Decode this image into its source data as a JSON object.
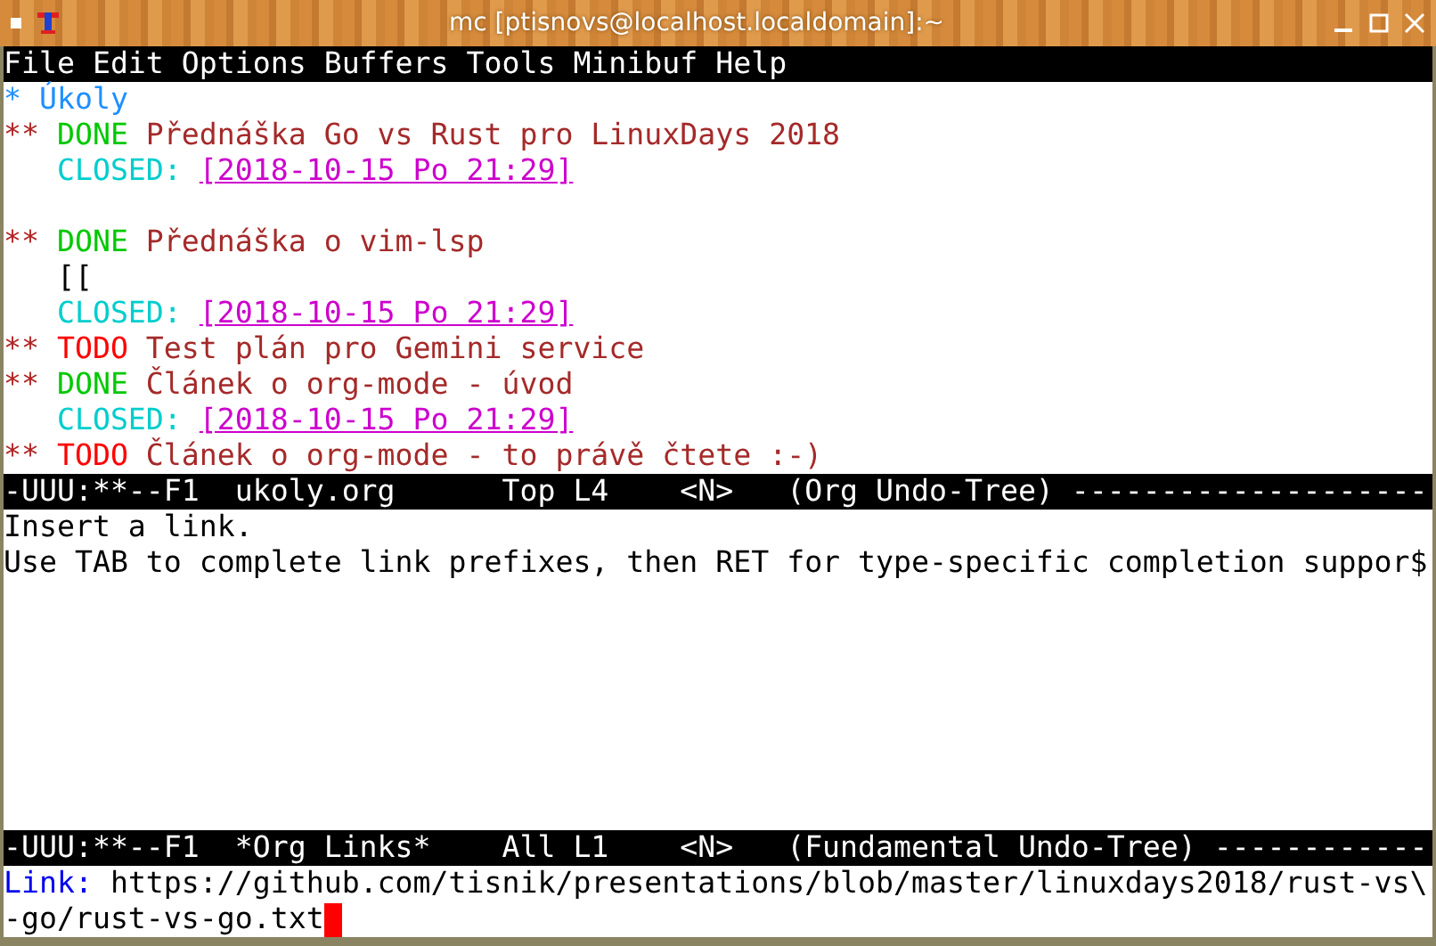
{
  "window": {
    "title": "mc [ptisnovs@localhost.localdomain]:~"
  },
  "menu": [
    "File",
    "Edit",
    "Options",
    "Buffers",
    "Tools",
    "Minibuf",
    "Help"
  ],
  "buffer": [
    {
      "kind": "line",
      "segments": [
        {
          "kind": "h1star",
          "text": "*"
        },
        {
          "kind": "h1",
          "text": "Úkoly"
        }
      ]
    },
    {
      "kind": "line",
      "segments": [
        {
          "kind": "stars",
          "text": "**"
        },
        {
          "kind": "done",
          "text": "DONE"
        },
        {
          "kind": "heading",
          "text": "Přednáška Go vs Rust pro LinuxDays 2018"
        }
      ]
    },
    {
      "kind": "body",
      "segments": [
        {
          "kind": "property",
          "text": "CLOSED:"
        },
        {
          "kind": "timestamp",
          "text": "[2018-10-15 Po 21:29]"
        }
      ]
    },
    {
      "kind": "blank"
    },
    {
      "kind": "line",
      "segments": [
        {
          "kind": "stars",
          "text": "**"
        },
        {
          "kind": "done",
          "text": "DONE"
        },
        {
          "kind": "heading",
          "text": "Přednáška o vim-lsp"
        }
      ]
    },
    {
      "kind": "body",
      "segments": [
        {
          "kind": "plain",
          "text": "[["
        }
      ]
    },
    {
      "kind": "body",
      "segments": [
        {
          "kind": "property",
          "text": "CLOSED:"
        },
        {
          "kind": "timestamp",
          "text": "[2018-10-15 Po 21:29]"
        }
      ]
    },
    {
      "kind": "line",
      "segments": [
        {
          "kind": "stars",
          "text": "**"
        },
        {
          "kind": "todo",
          "text": "TODO"
        },
        {
          "kind": "heading",
          "text": "Test plán pro Gemini service"
        }
      ]
    },
    {
      "kind": "line",
      "segments": [
        {
          "kind": "stars",
          "text": "**"
        },
        {
          "kind": "done",
          "text": "DONE"
        },
        {
          "kind": "heading",
          "text": "Článek o org-mode - úvod"
        }
      ]
    },
    {
      "kind": "body",
      "segments": [
        {
          "kind": "property",
          "text": "CLOSED:"
        },
        {
          "kind": "timestamp",
          "text": "[2018-10-15 Po 21:29]"
        }
      ]
    },
    {
      "kind": "line",
      "segments": [
        {
          "kind": "stars",
          "text": "**"
        },
        {
          "kind": "todo",
          "text": "TODO"
        },
        {
          "kind": "heading",
          "text": "Článek o org-mode - to právě čtete :-)"
        }
      ]
    }
  ],
  "mode_line_top": "-UUU:**--F1  ukoly.org      Top L4    <N>   (Org Undo-Tree) --------------------",
  "help": [
    "Insert a link.",
    "Use TAB to complete link prefixes, then RET for type-specific completion suppor$"
  ],
  "mode_line_bottom": "-UUU:**--F1  *Org Links*    All L1    <N>   (Fundamental Undo-Tree) ------------",
  "minibuffer": {
    "prompt": "Link:",
    "value_lines": [
      "https://github.com/tisnik/presentations/blob/master/linuxdays2018/rust-vs\\",
      "-go/rust-vs-go.txt"
    ]
  }
}
